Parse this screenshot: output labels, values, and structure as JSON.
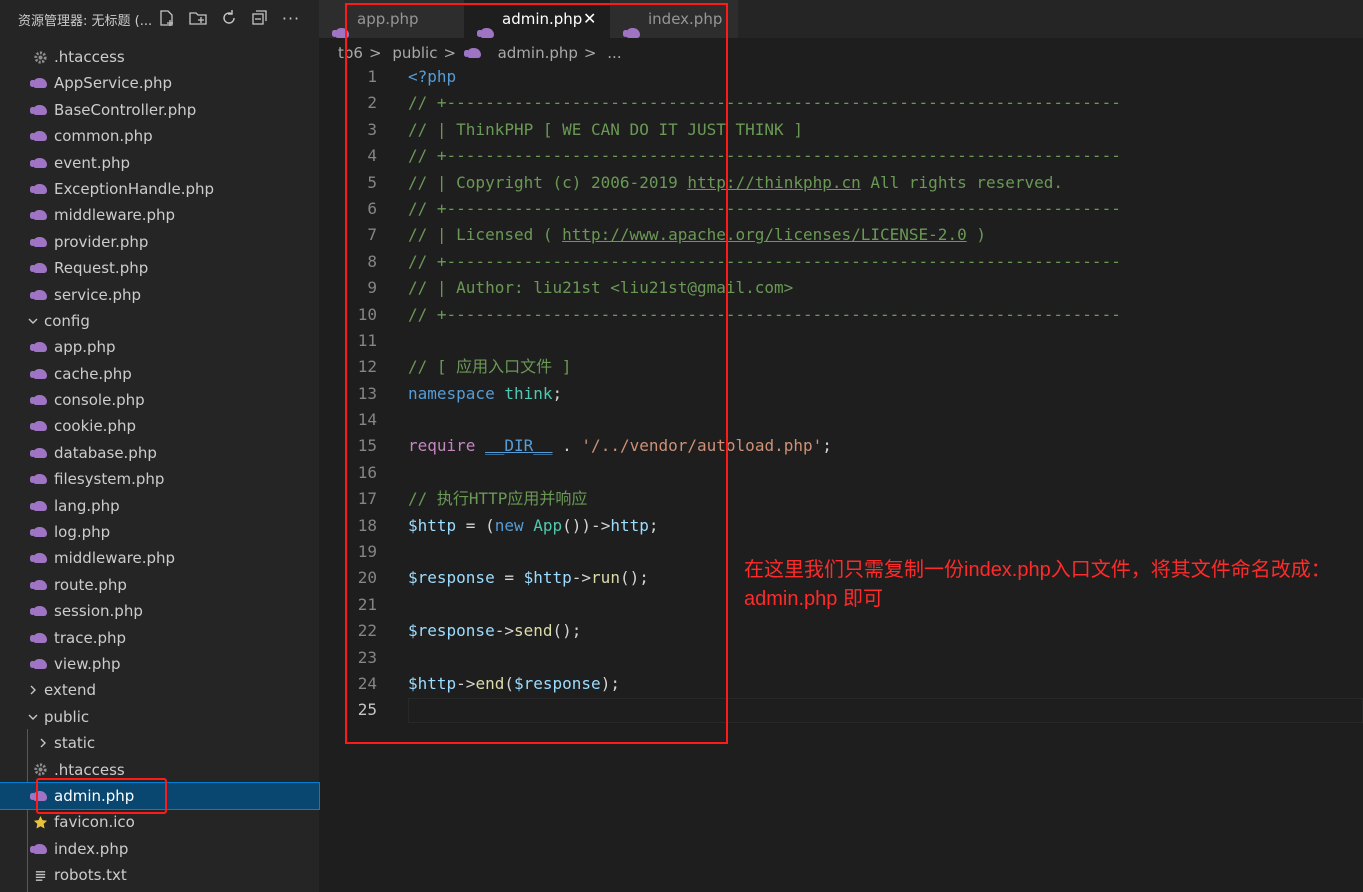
{
  "sidebar": {
    "title": "资源管理器: 无标题 (...",
    "actions": [
      "new-file-icon",
      "new-folder-icon",
      "refresh-icon",
      "collapse-all-icon",
      "more-icon"
    ],
    "more_label": "···",
    "items": [
      {
        "label": ".htaccess",
        "icon": "gear-icon",
        "depth": 1
      },
      {
        "label": "AppService.php",
        "icon": "php-icon",
        "depth": 1
      },
      {
        "label": "BaseController.php",
        "icon": "php-icon",
        "depth": 1
      },
      {
        "label": "common.php",
        "icon": "php-icon",
        "depth": 1
      },
      {
        "label": "event.php",
        "icon": "php-icon",
        "depth": 1
      },
      {
        "label": "ExceptionHandle.php",
        "icon": "php-icon",
        "depth": 1
      },
      {
        "label": "middleware.php",
        "icon": "php-icon",
        "depth": 1
      },
      {
        "label": "provider.php",
        "icon": "php-icon",
        "depth": 1
      },
      {
        "label": "Request.php",
        "icon": "php-icon",
        "depth": 1
      },
      {
        "label": "service.php",
        "icon": "php-icon",
        "depth": 1
      },
      {
        "label": "config",
        "icon": "chevron-down-icon",
        "depth": 0
      },
      {
        "label": "app.php",
        "icon": "php-icon",
        "depth": 1
      },
      {
        "label": "cache.php",
        "icon": "php-icon",
        "depth": 1
      },
      {
        "label": "console.php",
        "icon": "php-icon",
        "depth": 1
      },
      {
        "label": "cookie.php",
        "icon": "php-icon",
        "depth": 1
      },
      {
        "label": "database.php",
        "icon": "php-icon",
        "depth": 1
      },
      {
        "label": "filesystem.php",
        "icon": "php-icon",
        "depth": 1
      },
      {
        "label": "lang.php",
        "icon": "php-icon",
        "depth": 1
      },
      {
        "label": "log.php",
        "icon": "php-icon",
        "depth": 1
      },
      {
        "label": "middleware.php",
        "icon": "php-icon",
        "depth": 1
      },
      {
        "label": "route.php",
        "icon": "php-icon",
        "depth": 1
      },
      {
        "label": "session.php",
        "icon": "php-icon",
        "depth": 1
      },
      {
        "label": "trace.php",
        "icon": "php-icon",
        "depth": 1
      },
      {
        "label": "view.php",
        "icon": "php-icon",
        "depth": 1
      },
      {
        "label": "extend",
        "icon": "chevron-right-icon",
        "depth": 0
      },
      {
        "label": "public",
        "icon": "chevron-down-icon",
        "depth": 0
      },
      {
        "label": "static",
        "icon": "chevron-right-icon",
        "depth": 1
      },
      {
        "label": ".htaccess",
        "icon": "gear-icon",
        "depth": 1
      },
      {
        "label": "admin.php",
        "icon": "php-icon",
        "depth": 1,
        "selected": true
      },
      {
        "label": "favicon.ico",
        "icon": "star-icon",
        "depth": 1
      },
      {
        "label": "index.php",
        "icon": "php-icon",
        "depth": 1
      },
      {
        "label": "robots.txt",
        "icon": "text-file-icon",
        "depth": 1
      }
    ]
  },
  "tabs": [
    {
      "label": "app.php",
      "active": false
    },
    {
      "label": "admin.php",
      "active": true,
      "close": "✕"
    },
    {
      "label": "index.php",
      "active": false
    }
  ],
  "breadcrumb": [
    "tp6",
    "public",
    "admin.php",
    "..."
  ],
  "breadcrumb_sep": ">",
  "editor": {
    "current_line": 25,
    "lines": [
      {
        "n": "1"
      },
      {
        "n": "2"
      },
      {
        "n": "3"
      },
      {
        "n": "4"
      },
      {
        "n": "5"
      },
      {
        "n": "6"
      },
      {
        "n": "7"
      },
      {
        "n": "8"
      },
      {
        "n": "9"
      },
      {
        "n": "10"
      },
      {
        "n": "11"
      },
      {
        "n": "12"
      },
      {
        "n": "13"
      },
      {
        "n": "14"
      },
      {
        "n": "15"
      },
      {
        "n": "16"
      },
      {
        "n": "17"
      },
      {
        "n": "18"
      },
      {
        "n": "19"
      },
      {
        "n": "20"
      },
      {
        "n": "21"
      },
      {
        "n": "22"
      },
      {
        "n": "23"
      },
      {
        "n": "24"
      },
      {
        "n": "25"
      }
    ],
    "tokens": {
      "l1": "<?php",
      "rule": "// +----------------------------------------------------------------------",
      "l3": "// | ThinkPHP [ WE CAN DO IT JUST THINK ]",
      "l5a": "// | Copyright (c) 2006-2019 ",
      "l5b": "http://thinkphp.cn",
      "l5c": " All rights reserved.",
      "l7a": "// | Licensed ( ",
      "l7b": "http://www.apache.org/licenses/LICENSE-2.0",
      "l7c": " )",
      "l9": "// | Author: liu21st <liu21st@gmail.com>",
      "l12": "// [ 应用入口文件 ]",
      "namespace": "namespace",
      "think": "think",
      "semi": ";",
      "require": "require",
      "dir": "__DIR__",
      "dot": " . ",
      "path": "'/../vendor/autoload.php'",
      "l17": "// 执行HTTP应用并响应",
      "http_var": "$http",
      "assign": " = (",
      "new": "new",
      "app": "App",
      "l18tail": "())->",
      "http_prop": "http",
      "response_var": "$response",
      "assign2": " = ",
      "arrow": "->",
      "run": "run",
      "send": "send",
      "end": "end",
      "call_end": "();",
      "lparen": "(",
      "rparen_semi": ");"
    }
  },
  "annotation": {
    "note": "在这里我们只需复制一份index.php入口文件，将其文件命名改成：admin.php 即可",
    "color": "#ff1a1a"
  }
}
